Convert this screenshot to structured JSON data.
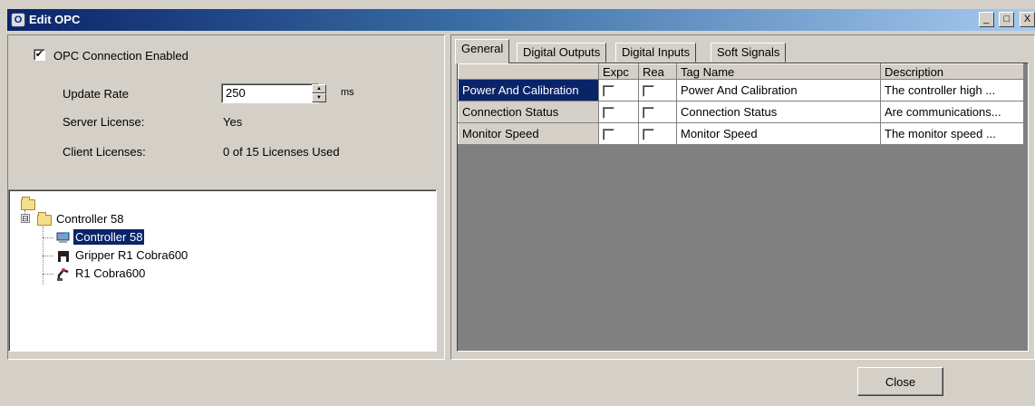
{
  "window": {
    "title": "Edit OPC",
    "icon": "opc-icon",
    "controls": {
      "minimize": "_",
      "maximize": "□",
      "close": "X"
    }
  },
  "settings": {
    "opc_enabled_label": "OPC Connection Enabled",
    "opc_enabled_checked": true,
    "update_rate_label": "Update Rate",
    "update_rate_value": "250",
    "update_rate_unit": "ms",
    "server_license_label": "Server License:",
    "server_license_value": "Yes",
    "client_licenses_label": "Client Licenses:",
    "client_licenses_value": "0 of 15 Licenses Used"
  },
  "tree": {
    "root_icon": "folder-icon",
    "controller": {
      "label": "Controller 58",
      "icon": "folder-icon",
      "expander": "⊟"
    },
    "children": [
      {
        "label": "Controller 58",
        "icon": "controller-icon",
        "selected": true
      },
      {
        "label": "Gripper R1 Cobra600",
        "icon": "gripper-icon",
        "selected": false
      },
      {
        "label": "R1 Cobra600",
        "icon": "robot-arm-icon",
        "selected": false
      }
    ]
  },
  "tabs": [
    {
      "label": "General",
      "active": true
    },
    {
      "label": "Digital Outputs",
      "active": false
    },
    {
      "label": "Digital Inputs",
      "active": false
    },
    {
      "label": "Soft Signals",
      "active": false
    }
  ],
  "grid": {
    "columns": [
      "",
      "Expc",
      "Rea",
      "Tag Name",
      "Description"
    ],
    "rows": [
      {
        "name": "Power And Calibration",
        "expose": false,
        "read": false,
        "tag": "Power And Calibration",
        "description": "The controller high ...",
        "selected": true
      },
      {
        "name": "Connection Status",
        "expose": false,
        "read": false,
        "tag": "Connection Status",
        "description": "Are communications...",
        "selected": false
      },
      {
        "name": "Monitor Speed",
        "expose": false,
        "read": false,
        "tag": "Monitor Speed",
        "description": "The monitor speed ...",
        "selected": false
      }
    ]
  },
  "footer": {
    "close_label": "Close"
  }
}
